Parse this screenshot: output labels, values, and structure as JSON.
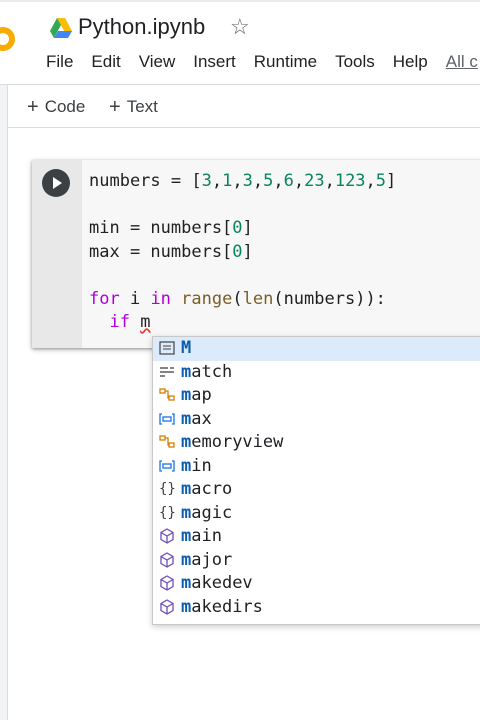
{
  "header": {
    "title": "Python.ipynb",
    "menu": [
      "File",
      "Edit",
      "View",
      "Insert",
      "Runtime",
      "Tools",
      "Help"
    ],
    "all_changes": "All c",
    "logo_color": "#f9ab00",
    "drive_icon": "google-drive-icon",
    "star_icon": "star-icon"
  },
  "toolbar": {
    "add_code": "Code",
    "add_text": "Text"
  },
  "cell": {
    "lines": [
      "numbers = [3,1,3,5,6,23,123,5]",
      "",
      "min = numbers[0]",
      "max = numbers[0]",
      "",
      "for i in range(len(numbers)):",
      "  if m"
    ]
  },
  "autocomplete": {
    "typed": "m",
    "items": [
      {
        "label": "M",
        "icon": "text-icon",
        "selected": true
      },
      {
        "label": "match",
        "icon": "keyword-icon"
      },
      {
        "label": "map",
        "icon": "class-icon"
      },
      {
        "label": "max",
        "icon": "variable-icon"
      },
      {
        "label": "memoryview",
        "icon": "class-icon"
      },
      {
        "label": "min",
        "icon": "variable-icon"
      },
      {
        "label": "macro",
        "icon": "snippet-icon"
      },
      {
        "label": "magic",
        "icon": "snippet-icon"
      },
      {
        "label": "main",
        "icon": "module-icon"
      },
      {
        "label": "major",
        "icon": "module-icon"
      },
      {
        "label": "makedev",
        "icon": "module-icon"
      },
      {
        "label": "makedirs",
        "icon": "module-icon"
      }
    ]
  }
}
